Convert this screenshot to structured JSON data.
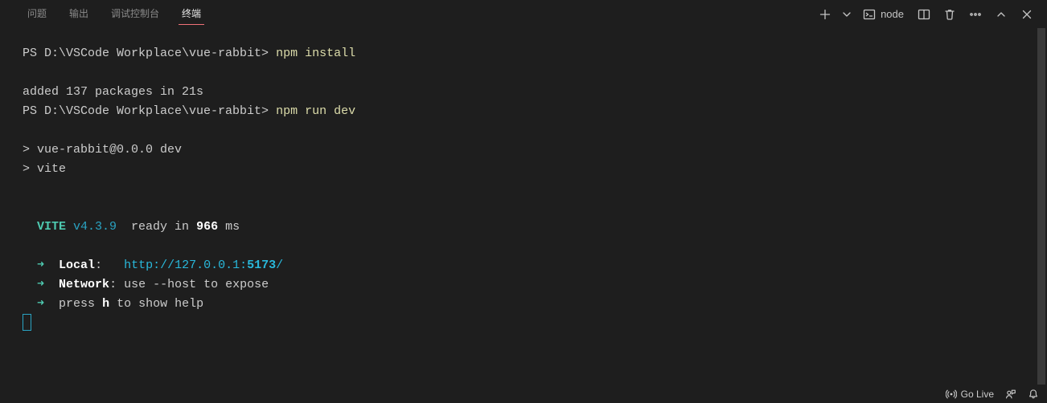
{
  "tabs": {
    "problems": "问题",
    "output": "输出",
    "debug_console": "调试控制台",
    "terminal": "终端"
  },
  "toolbar": {
    "launch_profile": "node"
  },
  "terminal": {
    "prompt1": "PS D:\\VSCode Workplace\\vue-rabbit> ",
    "cmd1": "npm install",
    "blank1": "",
    "added_line": "added 137 packages in 21s",
    "prompt2": "PS D:\\VSCode Workplace\\vue-rabbit> ",
    "cmd2": "npm run dev",
    "blank2": "",
    "script_line1": "> vue-rabbit@0.0.0 dev",
    "script_line2": "> vite",
    "blank3": "",
    "blank4": "",
    "vite_label": "  VITE ",
    "vite_version": "v4.3.9",
    "ready_pre": "  ready in ",
    "ready_time": "966",
    "ready_suf": " ms",
    "blank5": "",
    "arrow": "  ➜  ",
    "local_label": "Local",
    "local_sep": ":   ",
    "local_url_a": "http://127.0.0.1:",
    "local_url_port": "5173",
    "local_url_b": "/",
    "net_label": "Network",
    "net_rest": ": use --host to expose",
    "help_pre": "press ",
    "help_key": "h",
    "help_suf": " to show help"
  },
  "statusbar": {
    "go_live": "Go Live"
  }
}
